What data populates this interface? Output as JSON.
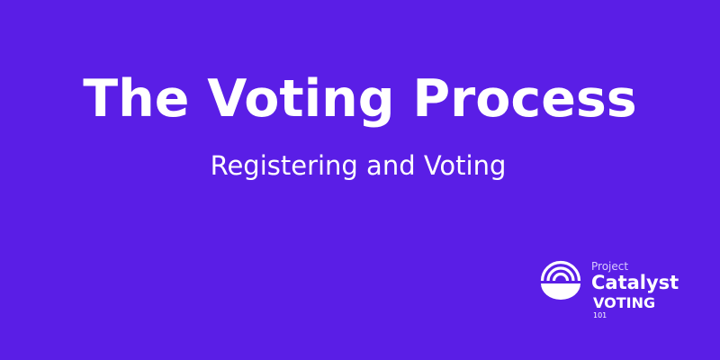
{
  "banner": {
    "title": "The Voting Process",
    "subtitle": "Registering and Voting",
    "background_color": "#5a1ee6",
    "text_color": "#ffffff"
  },
  "logo": {
    "line1": "Project",
    "line2": "Catalyst",
    "line3": "VOTING",
    "line4": "101",
    "icon": "catalyst-rainbow-icon"
  }
}
